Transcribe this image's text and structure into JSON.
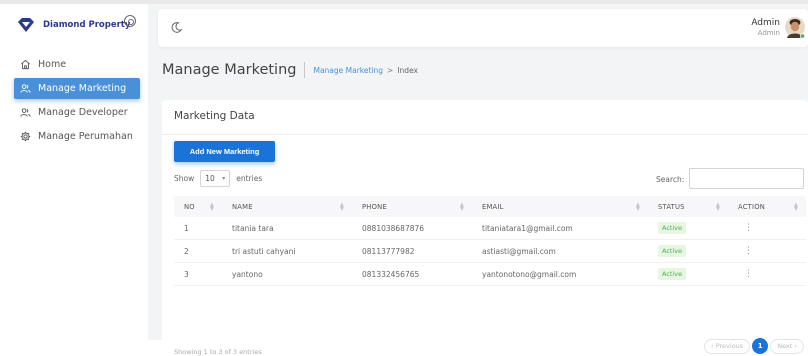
{
  "brand": {
    "name": "Diamond Property"
  },
  "sidebar": {
    "items": [
      {
        "label": "Home",
        "icon": "home-icon",
        "active": false
      },
      {
        "label": "Manage Marketing",
        "icon": "users-icon",
        "active": true
      },
      {
        "label": "Manage Developer",
        "icon": "users-icon",
        "active": false
      },
      {
        "label": "Manage Perumahan",
        "icon": "gear-icon",
        "active": false
      }
    ]
  },
  "header": {
    "user_name": "Admin",
    "user_role": "Admin"
  },
  "page": {
    "title": "Manage Marketing",
    "breadcrumb": {
      "link": "Manage Marketing",
      "separator": ">",
      "current": "Index"
    }
  },
  "card": {
    "title": "Marketing Data",
    "add_button": "Add New Marketing",
    "show_label": "Show",
    "entries_value": "10",
    "entries_label": "entries",
    "search_label": "Search:",
    "search_value": ""
  },
  "table": {
    "columns": [
      "NO",
      "NAME",
      "PHONE",
      "EMAIL",
      "STATUS",
      "ACTION"
    ],
    "rows": [
      {
        "no": "1",
        "name": "titania tara",
        "phone": "0881038687876",
        "email": "titaniatara1@gmail.com",
        "status": "Active"
      },
      {
        "no": "2",
        "name": "tri astuti cahyani",
        "phone": "08113777982",
        "email": "astiasti@gmail.com",
        "status": "Active"
      },
      {
        "no": "3",
        "name": "yantono",
        "phone": "081332456765",
        "email": "yantonotono@gmail.com",
        "status": "Active"
      }
    ],
    "action_glyph": "⋮"
  },
  "footer": {
    "info": "Showing 1 to 3 of 3 entries",
    "prev": "‹ Previous",
    "current_page": "1",
    "next": "Next ›"
  },
  "colors": {
    "primary": "#1a73d9",
    "sidebar_active": "#4a90d9",
    "brand": "#2b3a8f",
    "badge_bg": "#e6f6e0",
    "badge_text": "#4caf50"
  }
}
